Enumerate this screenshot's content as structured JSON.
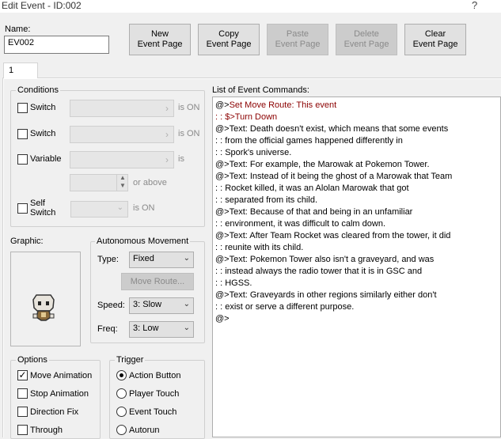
{
  "window": {
    "title": "Edit Event - ID:002",
    "help": "?"
  },
  "name": {
    "label": "Name:",
    "value": "EV002"
  },
  "toolbar": {
    "new_page": [
      "New",
      "Event Page"
    ],
    "copy_page": [
      "Copy",
      "Event Page"
    ],
    "paste_page": [
      "Paste",
      "Event Page"
    ],
    "delete_page": [
      "Delete",
      "Event Page"
    ],
    "clear_page": [
      "Clear",
      "Event Page"
    ]
  },
  "tabs": [
    "1"
  ],
  "conditions": {
    "title": "Conditions",
    "switch1": {
      "label": "Switch",
      "suffix": "is ON"
    },
    "switch2": {
      "label": "Switch",
      "suffix": "is ON"
    },
    "variable": {
      "label": "Variable",
      "suffix": "is",
      "or_above": "or above"
    },
    "self_switch": {
      "label_line1": "Self",
      "label_line2": "Switch",
      "suffix": "is ON"
    }
  },
  "graphic": {
    "title": "Graphic:"
  },
  "autonomous": {
    "title": "Autonomous Movement",
    "type_label": "Type:",
    "type_value": "Fixed",
    "move_route": "Move Route...",
    "speed_label": "Speed:",
    "speed_value": "3: Slow",
    "freq_label": "Freq:",
    "freq_value": "3: Low"
  },
  "options": {
    "title": "Options",
    "items": [
      {
        "label": "Move Animation",
        "checked": true
      },
      {
        "label": "Stop Animation",
        "checked": false
      },
      {
        "label": "Direction Fix",
        "checked": false
      },
      {
        "label": "Through",
        "checked": false
      }
    ]
  },
  "trigger": {
    "title": "Trigger",
    "items": [
      {
        "label": "Action Button",
        "selected": true
      },
      {
        "label": "Player Touch",
        "selected": false
      },
      {
        "label": "Event Touch",
        "selected": false
      },
      {
        "label": "Autorun",
        "selected": false
      }
    ]
  },
  "commands": {
    "title": "List of Event Commands:",
    "lines": [
      {
        "text": "@>Set Move Route: This event",
        "color": "red_partial"
      },
      {
        "text": " :                     : $>Turn Down",
        "color": "red"
      },
      {
        "text": "@>Text: Death doesn't exist, which means that some events"
      },
      {
        "text": " :         : from the official games happened differently in"
      },
      {
        "text": " :         : Spork's universe."
      },
      {
        "text": "@>Text: For example, the Marowak at Pokemon Tower."
      },
      {
        "text": "@>Text: Instead of it being the ghost of a Marowak that Team"
      },
      {
        "text": " :         : Rocket killed, it was an Alolan Marowak that got"
      },
      {
        "text": " :         : separated from its child."
      },
      {
        "text": "@>Text: Because of that and being in an unfamiliar"
      },
      {
        "text": " :         : environment, it was difficult to calm down."
      },
      {
        "text": "@>Text: After Team Rocket was cleared from the tower, it did"
      },
      {
        "text": " :         : reunite with its child."
      },
      {
        "text": "@>Text: Pokemon Tower also isn't a graveyard, and was"
      },
      {
        "text": " :         : instead always the radio tower that it is in GSC and"
      },
      {
        "text": " :         : HGSS."
      },
      {
        "text": "@>Text: Graveyards in other regions similarly either don't"
      },
      {
        "text": " :         : exist or serve a different purpose."
      },
      {
        "text": "@>"
      }
    ]
  }
}
